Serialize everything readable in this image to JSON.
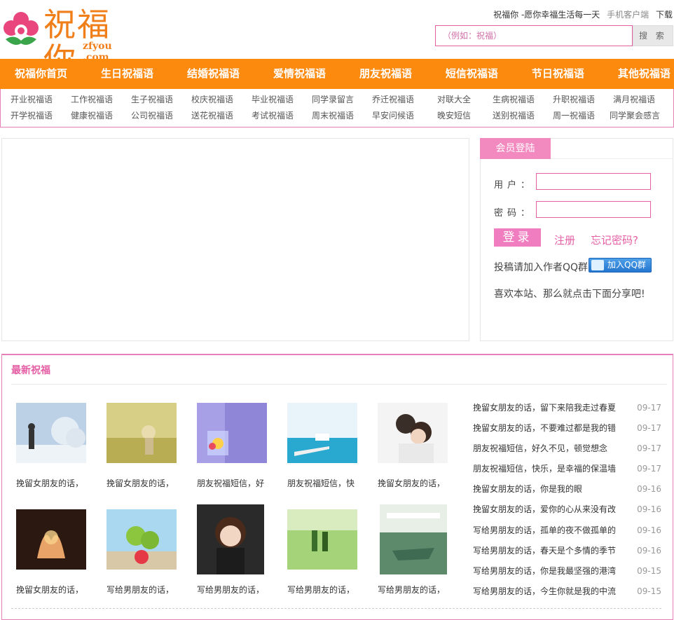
{
  "header": {
    "logo_text": "祝福你",
    "logo_domain": "zfyou .com",
    "slogan": "祝福你 -愿你幸福生活每一天",
    "mobile_link": "手机客户端",
    "download_link": "下载",
    "search_placeholder": "（例如：祝福）",
    "search_button": "搜 索"
  },
  "mainnav": [
    "祝福你首页",
    "生日祝福语",
    "结婚祝福语",
    "爱情祝福语",
    "朋友祝福语",
    "短信祝福语",
    "节日祝福语",
    "其他祝福语"
  ],
  "subnav": {
    "row1": [
      "开业祝福语",
      "工作祝福语",
      "生子祝福语",
      "校庆祝福语",
      "毕业祝福语",
      "同学录留言",
      "乔迁祝福语",
      "对联大全",
      "生病祝福语",
      "升职祝福语",
      "满月祝福语"
    ],
    "row2": [
      "开学祝福语",
      "健康祝福语",
      "公司祝福语",
      "送花祝福语",
      "考试祝福语",
      "周末祝福语",
      "早安问候语",
      "晚安短信",
      "送别祝福语",
      "周一祝福语",
      "同学聚会感言"
    ]
  },
  "login": {
    "tab": "会员登陆",
    "user_label": "用户：",
    "pass_label": "密码：",
    "login_button": "登录",
    "register": "注册",
    "forgot": "忘记密码?",
    "qq_text": "投稿请加入作者QQ群",
    "qq_button": "加入QQ群",
    "share_text": "喜欢本站、那么就点击下面分享吧!"
  },
  "latest": {
    "title": "最新祝福",
    "thumbs": [
      {
        "caption": "挽留女朋友的话，",
        "image": "winter-tree-scene"
      },
      {
        "caption": "挽留女朋友的话，",
        "image": "golden-field-girl"
      },
      {
        "caption": "朋友祝福短信，好",
        "image": "purple-flower-card"
      },
      {
        "caption": "朋友祝福短信，快",
        "image": "sea-pier-card"
      },
      {
        "caption": "挽留女朋友的话，",
        "image": "couple-portrait"
      },
      {
        "caption": "挽留女朋友的话，",
        "image": "hands-heart-light"
      },
      {
        "caption": "写给男朋友的话，",
        "image": "green-bear-toys"
      },
      {
        "caption": "写给男朋友的话，",
        "image": "girl-portrait"
      },
      {
        "caption": "写给男朋友的话，",
        "image": "couple-garden"
      },
      {
        "caption": "写给男朋友的话，",
        "image": "boat-lake-card"
      }
    ],
    "news": [
      {
        "title": "挽留女朋友的话，留下来陪我走过春夏",
        "date": "09-17"
      },
      {
        "title": "挽留女朋友的话，不要难过都是我的错",
        "date": "09-17"
      },
      {
        "title": "朋友祝福短信，好久不见，顿觉想念",
        "date": "09-17"
      },
      {
        "title": "朋友祝福短信，快乐，是幸福的保温墙",
        "date": "09-17"
      },
      {
        "title": "挽留女朋友的话，你是我的眼",
        "date": "09-16"
      },
      {
        "title": "挽留女朋友的话，爱你的心从来没有改",
        "date": "09-16"
      },
      {
        "title": "写给男朋友的话，孤单的夜不做孤单的",
        "date": "09-16"
      },
      {
        "title": "写给男朋友的话，春天是个多情的季节",
        "date": "09-16"
      },
      {
        "title": "写给男朋友的话，你是我最坚强的港湾",
        "date": "09-15"
      },
      {
        "title": "写给男朋友的话，今生你就是我的中流",
        "date": "09-15"
      }
    ]
  },
  "colors": {
    "nav_orange": "#fb8a0f",
    "pink": "#e55fa5",
    "logo_orange": "#f07f1a"
  }
}
